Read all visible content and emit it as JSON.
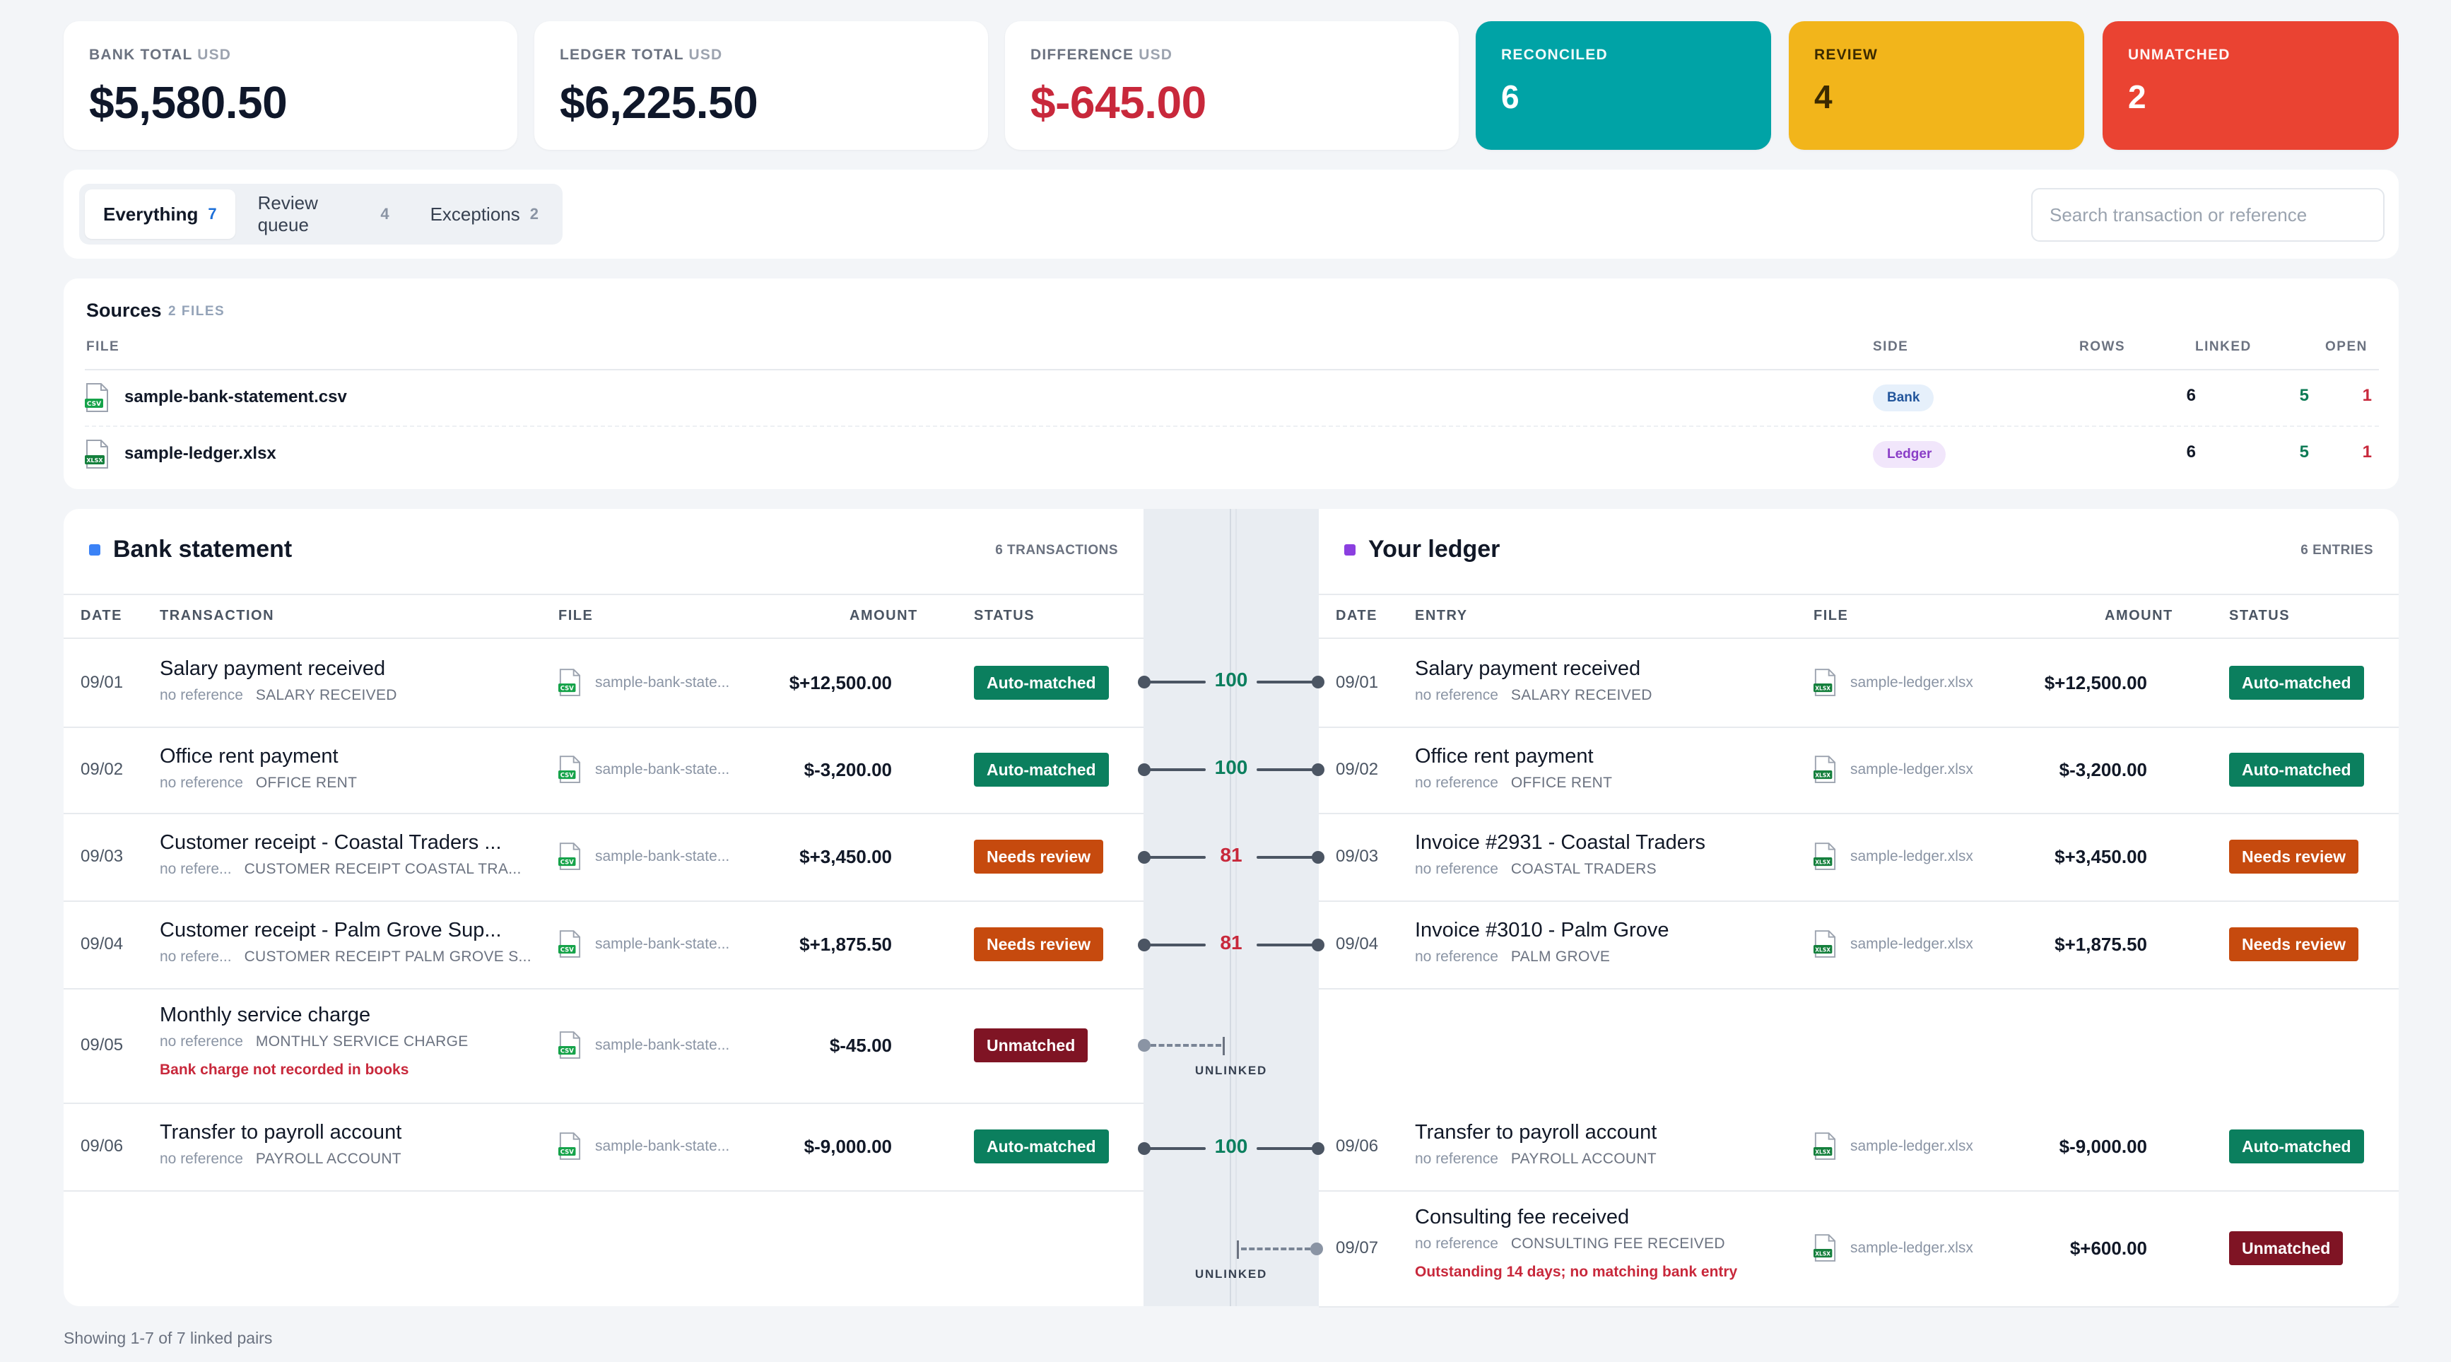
{
  "summary": {
    "bank_total": {
      "label": "BANK TOTAL",
      "unit": "USD",
      "value": "$5,580.50"
    },
    "ledger_total": {
      "label": "LEDGER TOTAL",
      "unit": "USD",
      "value": "$6,225.50"
    },
    "difference": {
      "label": "DIFFERENCE",
      "unit": "USD",
      "value": "$-645.00"
    },
    "reconciled": {
      "label": "RECONCILED",
      "value": "6",
      "color": "#00a3a6"
    },
    "review": {
      "label": "REVIEW",
      "value": "4",
      "color": "#f2b51b"
    },
    "unmatched": {
      "label": "UNMATCHED",
      "value": "2",
      "color": "#ea4332"
    }
  },
  "filters": {
    "tabs": [
      {
        "label": "Everything",
        "count": "7",
        "active": true
      },
      {
        "label": "Review queue",
        "count": "4",
        "active": false
      },
      {
        "label": "Exceptions",
        "count": "2",
        "active": false
      }
    ],
    "search_placeholder": "Search transaction or reference"
  },
  "sources": {
    "title": "Sources",
    "subtitle": "2 FILES",
    "headers": {
      "file": "FILE",
      "side": "SIDE",
      "rows": "ROWS",
      "linked": "LINKED",
      "open": "OPEN"
    },
    "files": [
      {
        "name": "sample-bank-statement.csv",
        "icon": "csv-file-icon",
        "side": "Bank",
        "rows": "6",
        "linked": "5",
        "open": "1"
      },
      {
        "name": "sample-ledger.xlsx",
        "icon": "xlsx-file-icon",
        "side": "Ledger",
        "rows": "6",
        "linked": "5",
        "open": "1"
      }
    ]
  },
  "bank": {
    "title": "Bank statement",
    "count": "6 TRANSACTIONS",
    "accent": "#3b82f6",
    "headers": {
      "date": "DATE",
      "desc": "TRANSACTION",
      "file": "FILE",
      "amount": "AMOUNT",
      "status": "STATUS"
    },
    "rows": [
      {
        "date": "09/01",
        "title": "Salary payment received",
        "ref": "no reference",
        "meta": "SALARY RECEIVED",
        "file": "sample-bank-state...",
        "amount": "$+12,500.00",
        "status": "Auto-matched"
      },
      {
        "date": "09/02",
        "title": "Office rent payment",
        "ref": "no reference",
        "meta": "OFFICE RENT",
        "file": "sample-bank-state...",
        "amount": "$-3,200.00",
        "status": "Auto-matched"
      },
      {
        "date": "09/03",
        "title": "Customer receipt - Coastal Traders ...",
        "ref": "no refere...",
        "meta": "CUSTOMER RECEIPT COASTAL TRA...",
        "file": "sample-bank-state...",
        "amount": "$+3,450.00",
        "status": "Needs review"
      },
      {
        "date": "09/04",
        "title": "Customer receipt - Palm Grove Sup...",
        "ref": "no refere...",
        "meta": "CUSTOMER RECEIPT PALM GROVE S...",
        "file": "sample-bank-state...",
        "amount": "$+1,875.50",
        "status": "Needs review"
      },
      {
        "date": "09/05",
        "title": "Monthly service charge",
        "ref": "no reference",
        "meta": "MONTHLY SERVICE CHARGE",
        "note": "Bank charge not recorded in books",
        "file": "sample-bank-state...",
        "amount": "$-45.00",
        "status": "Unmatched"
      },
      {
        "date": "09/06",
        "title": "Transfer to payroll account",
        "ref": "no reference",
        "meta": "PAYROLL ACCOUNT",
        "file": "sample-bank-state...",
        "amount": "$-9,000.00",
        "status": "Auto-matched"
      }
    ]
  },
  "ledger": {
    "title": "Your ledger",
    "count": "6 ENTRIES",
    "accent": "#8b3fe0",
    "headers": {
      "date": "DATE",
      "desc": "ENTRY",
      "file": "FILE",
      "amount": "AMOUNT",
      "status": "STATUS"
    },
    "rows": [
      {
        "date": "09/01",
        "title": "Salary payment received",
        "ref": "no reference",
        "meta": "SALARY RECEIVED",
        "file": "sample-ledger.xlsx",
        "amount": "$+12,500.00",
        "status": "Auto-matched"
      },
      {
        "date": "09/02",
        "title": "Office rent payment",
        "ref": "no reference",
        "meta": "OFFICE RENT",
        "file": "sample-ledger.xlsx",
        "amount": "$-3,200.00",
        "status": "Auto-matched"
      },
      {
        "date": "09/03",
        "title": "Invoice #2931 - Coastal Traders",
        "ref": "no reference",
        "meta": "COASTAL TRADERS",
        "file": "sample-ledger.xlsx",
        "amount": "$+3,450.00",
        "status": "Needs review"
      },
      {
        "date": "09/04",
        "title": "Invoice #3010 - Palm Grove",
        "ref": "no reference",
        "meta": "PALM GROVE",
        "file": "sample-ledger.xlsx",
        "amount": "$+1,875.50",
        "status": "Needs review"
      },
      {
        "date": "09/06",
        "title": "Transfer to payroll account",
        "ref": "no reference",
        "meta": "PAYROLL ACCOUNT",
        "file": "sample-ledger.xlsx",
        "amount": "$-9,000.00",
        "status": "Auto-matched"
      },
      {
        "date": "09/07",
        "title": "Consulting fee received",
        "ref": "no reference",
        "meta": "CONSULTING FEE RECEIVED",
        "note": "Outstanding 14 days; no matching bank entry",
        "file": "sample-ledger.xlsx",
        "amount": "$+600.00",
        "status": "Unmatched"
      }
    ]
  },
  "links": {
    "scores": [
      "100",
      "100",
      "81",
      "81",
      "100"
    ],
    "unlinked_label": "UNLINKED"
  },
  "footer": "Showing 1-7 of 7 linked pairs"
}
